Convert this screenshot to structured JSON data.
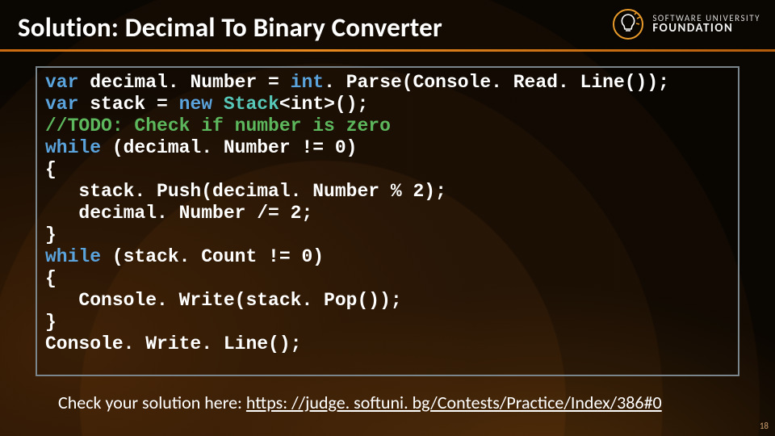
{
  "title": "Solution: Decimal To Binary Converter",
  "logo": {
    "line1": "SOFTWARE UNIVERSITY",
    "line2": "FOUNDATION"
  },
  "code": {
    "l1": {
      "kw_var": "var",
      "ident": " decimal. Number = ",
      "kw_int": "int",
      "rest": ". Parse(Console. Read. Line());"
    },
    "l2": {
      "kw_var": "var",
      "mid1": " stack = ",
      "kw_new": "new",
      "sp": " ",
      "typ": "Stack",
      "rest": "<int>();"
    },
    "l3": {
      "cmt": "//TODO: Check if number is zero"
    },
    "l4": {
      "kw_while": "while",
      "rest": " (decimal. Number != 0)"
    },
    "l5": {
      "brace": "{"
    },
    "l6": {
      "indent": "   stack. Push(decimal. Number % 2);"
    },
    "l7": {
      "indent": "   decimal. Number /= 2;"
    },
    "l8": {
      "brace": "}"
    },
    "l9": {
      "kw_while": "while",
      "rest": " (stack. Count != 0)"
    },
    "l10": {
      "brace": "{"
    },
    "l11": {
      "indent": "   Console. Write(stack. Pop());"
    },
    "l12": {
      "brace": "}"
    },
    "l13": {
      "txt": "Console. Write. Line();"
    }
  },
  "check": {
    "prefix": "Check your solution here: ",
    "link": "https: //judge. softuni. bg/Contests/Practice/Index/386#0"
  },
  "page_number": "18"
}
